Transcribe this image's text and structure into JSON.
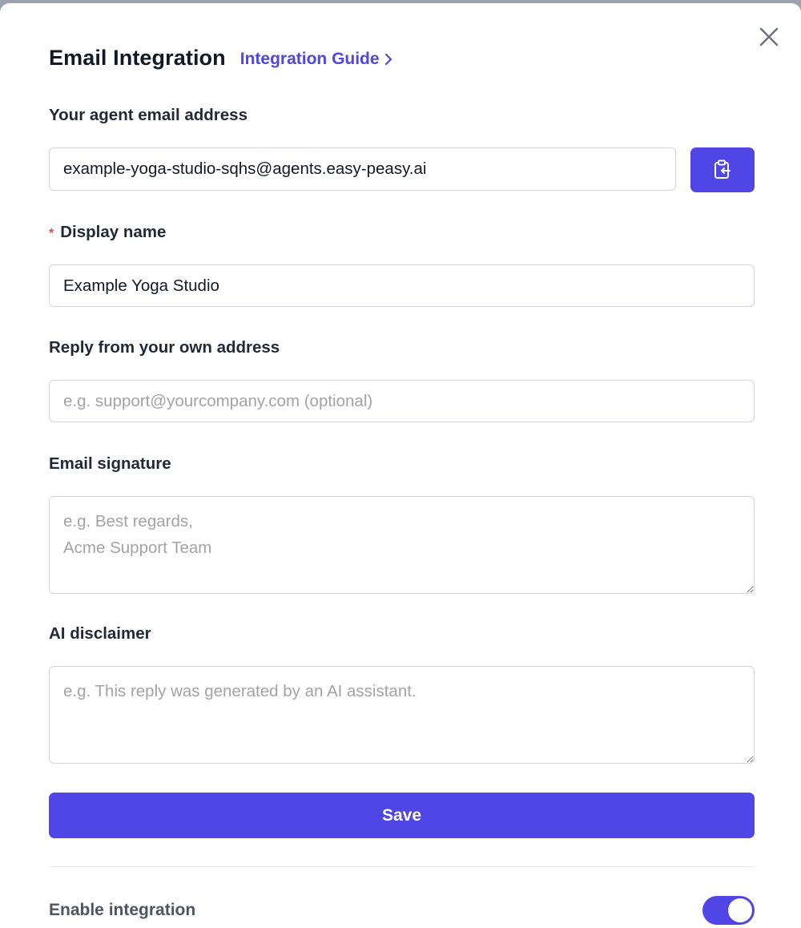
{
  "modal": {
    "title": "Email Integration",
    "guide_link": "Integration Guide"
  },
  "agent_email": {
    "label": "Your agent email address",
    "value": "example-yoga-studio-sqhs@agents.easy-peasy.ai",
    "copy_icon": "clipboard-copy-icon"
  },
  "display_name": {
    "required_marker": "*",
    "label": "Display name",
    "value": "Example Yoga Studio"
  },
  "reply_address": {
    "label": "Reply from your own address",
    "placeholder": "e.g. support@yourcompany.com (optional)"
  },
  "signature": {
    "label": "Email signature",
    "placeholder": "e.g. Best regards,\nAcme Support Team"
  },
  "disclaimer": {
    "label": "AI disclaimer",
    "placeholder": "e.g. This reply was generated by an AI assistant."
  },
  "save_label": "Save",
  "enable": {
    "label": "Enable integration",
    "enabled": true
  },
  "colors": {
    "accent": "#4f46e5",
    "required": "#ef4444"
  }
}
